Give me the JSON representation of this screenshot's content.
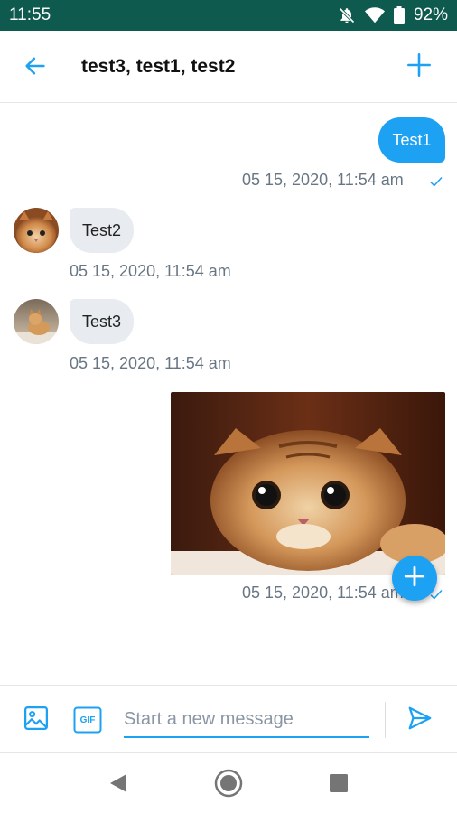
{
  "status_bar": {
    "time": "11:55",
    "battery": "92%",
    "icons": [
      "bell-off-icon",
      "wifi-icon",
      "battery-icon"
    ]
  },
  "header": {
    "title": "test3, test1, test2",
    "back_icon": "arrow-left-icon",
    "add_icon": "plus-icon"
  },
  "messages": [
    {
      "direction": "outgoing",
      "text": "Test1",
      "timestamp": "05 15, 2020, 11:54 am",
      "read": true
    },
    {
      "direction": "incoming",
      "text": "Test2",
      "timestamp": "05 15, 2020, 11:54 am",
      "avatar": "cat-avatar"
    },
    {
      "direction": "incoming",
      "text": "Test3",
      "timestamp": "05 15, 2020, 11:54 am",
      "avatar": "cat-avatar"
    },
    {
      "direction": "outgoing",
      "type": "image",
      "image": "cat-photo",
      "timestamp": "05 15, 2020, 11:54 am",
      "read": true
    }
  ],
  "composer": {
    "placeholder": "Start a new message",
    "value": "",
    "gif_label": "GIF"
  },
  "colors": {
    "accent": "#1da1f2",
    "status_bar": "#0f5a4e",
    "incoming_bubble": "#e8ecf0",
    "timestamp": "#687684"
  }
}
